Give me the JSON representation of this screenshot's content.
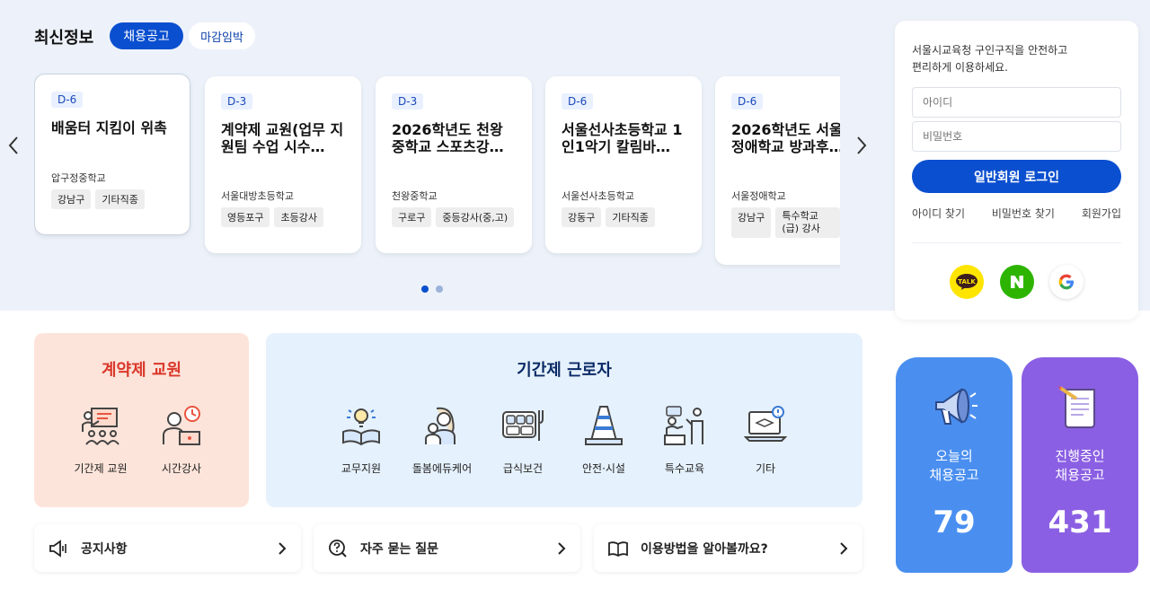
{
  "header": {
    "title": "최신정보",
    "tab_active": "채용공고",
    "tab_other": "마감임박"
  },
  "carousel": {
    "prev_icon": "chevron-left-icon",
    "next_icon": "chevron-right-icon",
    "cards": [
      {
        "dday": "D-6",
        "title": "배움터 지킴이 위촉",
        "school": "압구정중학교",
        "tags": [
          "강남구",
          "기타직종"
        ]
      },
      {
        "dday": "D-3",
        "title": "계약제 교원(업무 지원팀 수업 시수…",
        "school": "서울대방초등학교",
        "tags": [
          "영등포구",
          "초등강사"
        ]
      },
      {
        "dday": "D-3",
        "title": "2026학년도 천왕 중학교 스포츠강…",
        "school": "천왕중학교",
        "tags": [
          "구로구",
          "중등강사(중,고)"
        ]
      },
      {
        "dday": "D-6",
        "title": "서울선사초등학교 1인1악기 칼림바…",
        "school": "서울선사초등학교",
        "tags": [
          "강동구",
          "기타직종"
        ]
      },
      {
        "dday": "D-6",
        "title": "2026학년도 서울 정애학교 방과후…",
        "school": "서울정애학교",
        "tags": [
          "강남구",
          "특수학교(급) 강사"
        ]
      }
    ],
    "pages": 2,
    "current_page": 1
  },
  "login": {
    "message": "서울시교육청 구인구직을 안전하고\n편리하게 이용하세요.",
    "id_placeholder": "아이디",
    "pw_placeholder": "비밀번호",
    "login_button": "일반회원 로그인",
    "find_id": "아이디 찾기",
    "find_pw": "비밀번호 찾기",
    "signup": "회원가입",
    "social": [
      {
        "name": "kakao",
        "label": "TALK",
        "color": "#fee500"
      },
      {
        "name": "naver",
        "label": "N",
        "color": "#2db400"
      },
      {
        "name": "google",
        "label": "G",
        "color": "#ffffff"
      }
    ]
  },
  "contract": {
    "title": "계약제 교원",
    "title_color": "#d9382a",
    "items": [
      {
        "label": "기간제 교원",
        "icon": "teacher-board-icon"
      },
      {
        "label": "시간강사",
        "icon": "clock-teacher-icon"
      }
    ]
  },
  "period": {
    "title": "기간제 근로자",
    "title_color": "#0b2a66",
    "items": [
      {
        "label": "교무지원",
        "icon": "lightbulb-book-icon"
      },
      {
        "label": "돌봄에듀케어",
        "icon": "caregiver-icon"
      },
      {
        "label": "급식보건",
        "icon": "meal-tray-icon"
      },
      {
        "label": "안전·시설",
        "icon": "traffic-cone-icon"
      },
      {
        "label": "특수교육",
        "icon": "special-education-icon"
      },
      {
        "label": "기타",
        "icon": "laptop-other-icon"
      }
    ]
  },
  "bars": [
    {
      "label": "공지사항",
      "icon": "megaphone-outline-icon"
    },
    {
      "label": "자주 묻는 질문",
      "icon": "question-search-icon"
    },
    {
      "label": "이용방법을 알아볼까요?",
      "icon": "open-book-icon"
    }
  ],
  "stats": [
    {
      "label": "오늘의\n채용공고",
      "value": "79",
      "color": "#4a8ff0",
      "icon": "megaphone-icon"
    },
    {
      "label": "진행중인\n채용공고",
      "value": "431",
      "color": "#8b5fe3",
      "icon": "document-scroll-icon"
    }
  ]
}
